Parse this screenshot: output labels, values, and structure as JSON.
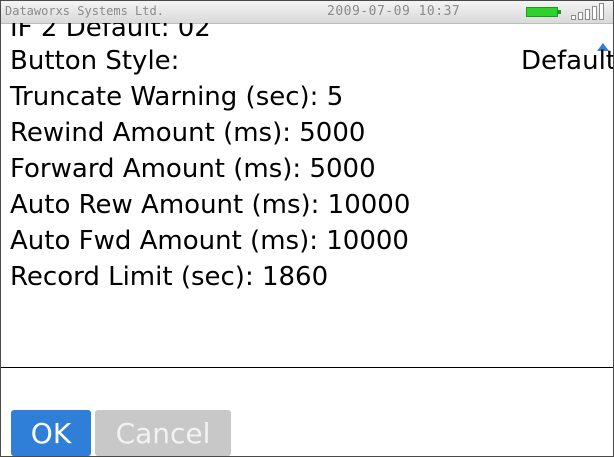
{
  "status_bar": {
    "company": "Dataworxs Systems Ltd.",
    "datetime": "2009-07-09 10:37",
    "battery_icon": "battery-icon",
    "signal_icon": "signal-strength-icon"
  },
  "settings": {
    "rows": [
      {
        "label": "IF 2 Default: 02"
      },
      {
        "label": "Button Style:",
        "value": "Default"
      },
      {
        "label": "Truncate Warning (sec): 5"
      },
      {
        "label": "Rewind Amount (ms): 5000"
      },
      {
        "label": "Forward Amount (ms): 5000"
      },
      {
        "label": "Auto Rew Amount (ms): 10000"
      },
      {
        "label": "Auto Fwd Amount (ms): 10000"
      },
      {
        "label": "Record Limit (sec): 1860"
      }
    ]
  },
  "buttons": {
    "ok": "OK",
    "cancel": "Cancel"
  },
  "colors": {
    "accent": "#2f7fd8",
    "disabled": "#c8c8c8",
    "battery": "#2fd12f"
  }
}
